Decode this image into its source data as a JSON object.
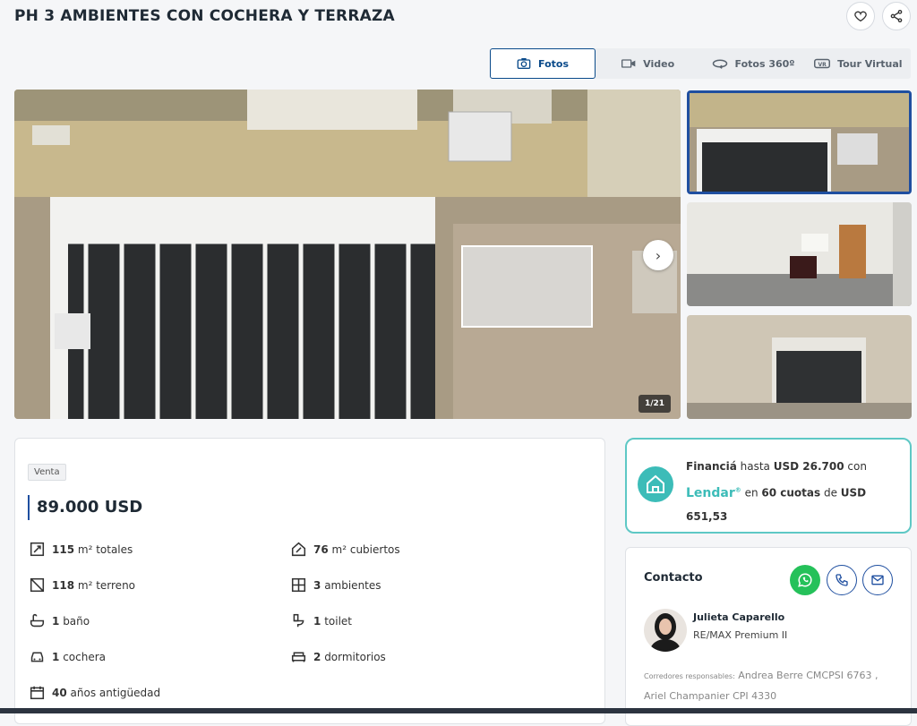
{
  "header": {
    "title": "PH 3 AMBIENTES CON COCHERA Y TERRAZA"
  },
  "tabs": [
    {
      "label": "Fotos",
      "icon": "camera-icon",
      "active": true
    },
    {
      "label": "Video",
      "icon": "video-icon",
      "active": false
    },
    {
      "label": "Fotos 360º",
      "icon": "360-icon",
      "active": false
    },
    {
      "label": "Tour Virtual",
      "icon": "vr-icon",
      "active": false
    }
  ],
  "gallery": {
    "counter": "1/21"
  },
  "listing": {
    "operation": "Venta",
    "price": "89.000 USD",
    "features": [
      {
        "value": "115",
        "label": "m² totales",
        "icon": "total-area-icon"
      },
      {
        "value": "76",
        "label": "m² cubiertos",
        "icon": "covered-area-icon"
      },
      {
        "value": "118",
        "label": "m² terreno",
        "icon": "land-area-icon"
      },
      {
        "value": "3",
        "label": "ambientes",
        "icon": "rooms-icon"
      },
      {
        "value": "1",
        "label": "baño",
        "icon": "bathtub-icon"
      },
      {
        "value": "1",
        "label": "toilet",
        "icon": "toilet-icon"
      },
      {
        "value": "1",
        "label": "cochera",
        "icon": "car-icon"
      },
      {
        "value": "2",
        "label": "dormitorios",
        "icon": "bed-icon"
      },
      {
        "value": "40",
        "label": "años antigüedad",
        "icon": "calendar-icon"
      }
    ]
  },
  "financing": {
    "prefix": "Financiá",
    "mid1": " hasta ",
    "amount": "USD 26.700",
    "mid2": " con",
    "brand": "Lendar",
    "brand_mark": "®",
    "mid3": " en ",
    "installments": "60 cuotas",
    "mid4": " de ",
    "installment_value": "USD 651,53"
  },
  "contact": {
    "heading": "Contacto",
    "agent_name": "Julieta Caparello",
    "agency": "RE/MAX Premium II",
    "responsible_label": "Corredores responsables:",
    "responsible_1": "Andrea Berre CMCPSI 6763 ,",
    "responsible_2": "Ariel Champanier CPI 4330"
  },
  "colors": {
    "accent": "#1f4fa0",
    "whatsapp": "#25c15a",
    "lendar": "#3cbcb8"
  }
}
